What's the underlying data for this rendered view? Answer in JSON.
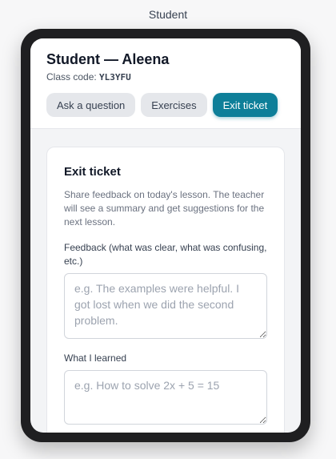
{
  "window": {
    "title": "Student"
  },
  "header": {
    "title": "Student — Aleena",
    "class_code_label": "Class code:",
    "class_code": "YL3YFU"
  },
  "tabs": [
    {
      "label": "Ask a question",
      "active": false
    },
    {
      "label": "Exercises",
      "active": false
    },
    {
      "label": "Exit ticket",
      "active": true
    }
  ],
  "exit_ticket": {
    "title": "Exit ticket",
    "description": "Share feedback on today's lesson. The teacher will see a summary and get suggestions for the next lesson.",
    "feedback_label": "Feedback (what was clear, what was confusing, etc.)",
    "feedback_value": "",
    "feedback_placeholder": "e.g. The examples were helpful. I got lost when we did the second problem.",
    "learned_label": "What I learned",
    "learned_value": "",
    "learned_placeholder": "e.g. How to solve 2x + 5 = 15"
  },
  "colors": {
    "accent": "#0e7f99",
    "tab_inactive": "#e5e7eb"
  }
}
